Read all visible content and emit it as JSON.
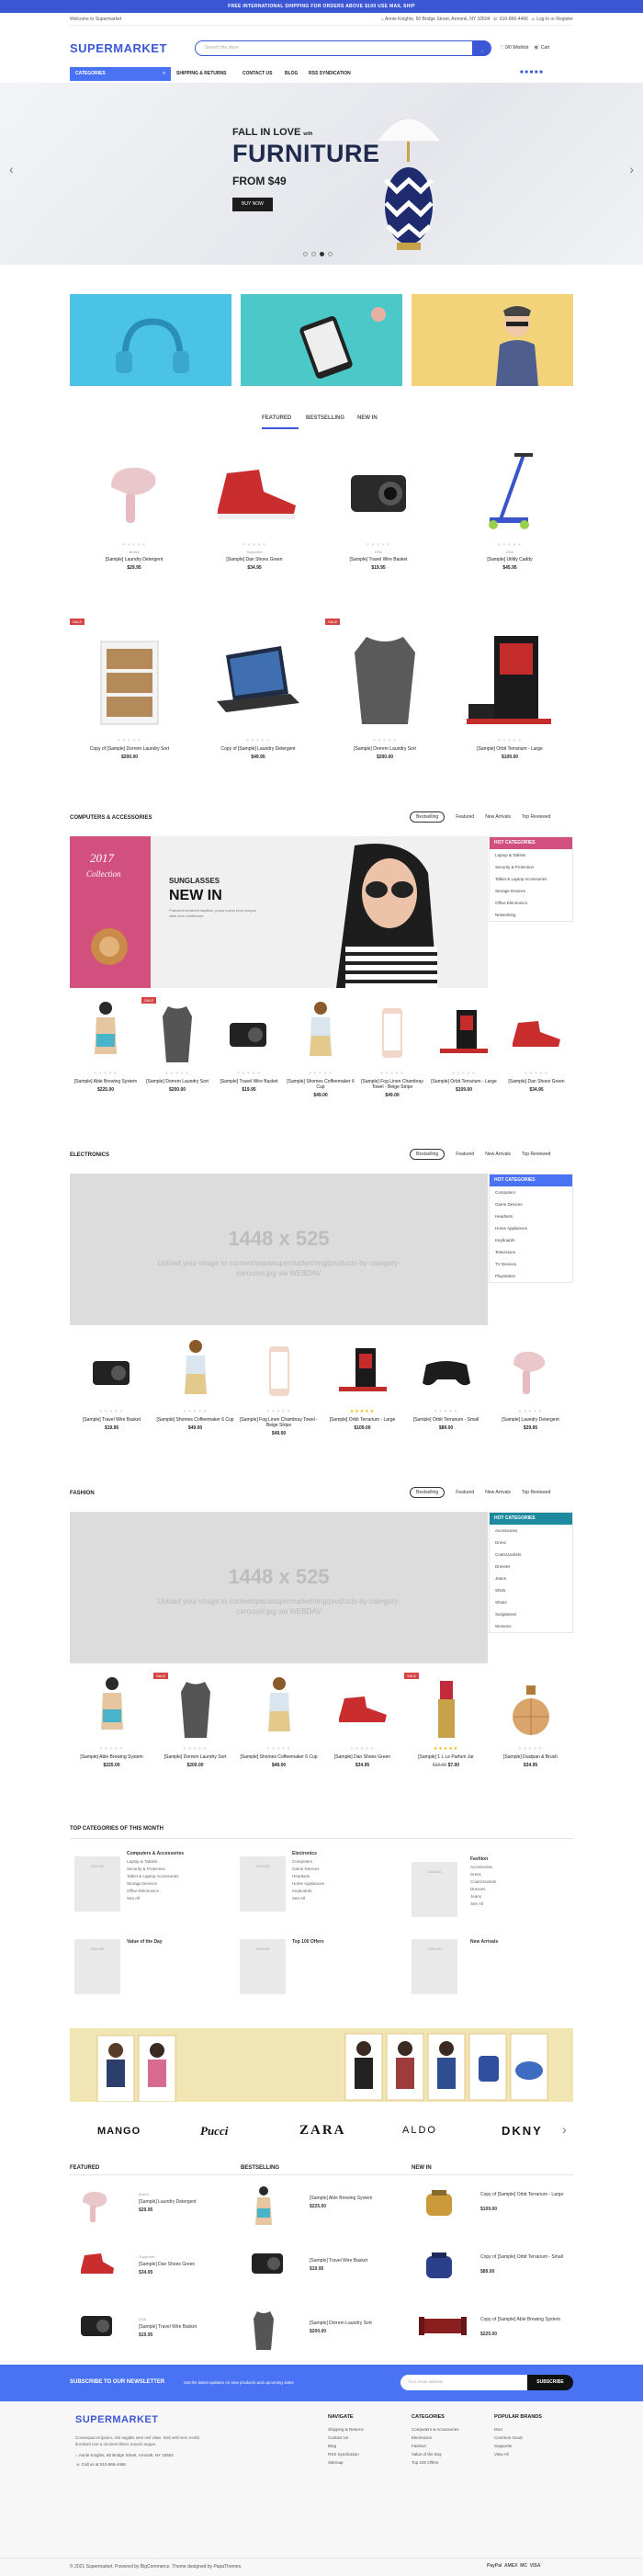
{
  "topbanner": "FREE INTERNATIONAL SHIPPING FOR ORDERS ABOVE $100 USE MAIL SHIP",
  "util": {
    "welcome": "Welcome to Supermarket",
    "address": "Annie Knights, 60 Bridge Street, Armonk, NY 10504",
    "phone": "610-866-4466",
    "login": "Log In or Register"
  },
  "header": {
    "logo": "SUPERMARKET",
    "search_placeholder": "Search the store",
    "wishlist": "0/0 Wishlist",
    "cart": "Cart"
  },
  "nav": {
    "categories": "CATEGORIES",
    "items": [
      "SHIPPING & RETURNS",
      "CONTACT US",
      "BLOG",
      "RSS SYNDICATION"
    ]
  },
  "hero": {
    "kicker": "FALL IN LOVE",
    "kicker_small": "with",
    "title": "FURNITURE",
    "price": "FROM $49",
    "button": "BUY NOW"
  },
  "tabs": [
    "FEATURED",
    "BESTSELLING",
    "NEW IN"
  ],
  "featured": [
    {
      "meta": "Brand",
      "name": "[Sample] Laundry Detergent",
      "price": "$29.95"
    },
    {
      "meta": "Supporter",
      "name": "[Sample] Dan Shoes Green",
      "price": "$34.95"
    },
    {
      "meta": "DSA",
      "name": "[Sample] Travel Wire Basket",
      "price": "$19.95"
    },
    {
      "meta": "DSA",
      "name": "[Sample] Utility Caddy",
      "price": "$45.95"
    },
    {
      "meta": "",
      "name": "Copy of [Sample] Dorrem Laundry Sort",
      "price": "$200.00",
      "badge": "SALE"
    },
    {
      "meta": "",
      "name": "Copy of [Sample] Laundry Detergent",
      "price": "$49.95"
    },
    {
      "meta": "",
      "name": "[Sample] Dorrem Laundry Sort",
      "price": "$200.00",
      "badge": "SALE"
    },
    {
      "meta": "",
      "name": "[Sample] Orbit Terrarium - Large",
      "price": "$109.00"
    }
  ],
  "sections": {
    "computers": {
      "title": "COMPUTERS & ACCESSORIES",
      "tabs": [
        "Bestselling",
        "Featured",
        "New Arrivals",
        "Top Reviewed"
      ],
      "banner_year": "2017",
      "banner_collection": "Collection",
      "banner_kicker": "SUNGLASSES",
      "banner_title": "NEW IN",
      "banner_text": "Praesent hendrerit dapibus, purus luctus eros congue vitae sem vestibulum.",
      "hot": "HOT CATEGORIES",
      "hot_items": [
        "Laptop & Tablets",
        "Security & Protection",
        "Tablet & Laptop Accessories",
        "Storage Devices",
        "Office Electronics",
        "Networking"
      ],
      "products": [
        {
          "name": "[Sample] Able Brewing System",
          "price": "$225.00"
        },
        {
          "name": "[Sample] Dorrem Laundry Sort",
          "price": "$200.00",
          "badge": "SALE"
        },
        {
          "name": "[Sample] Travel Wire Basket",
          "price": "$19.95"
        },
        {
          "name": "[Sample] Shomes Coffeemaker 6 Cup",
          "price": "$49.00"
        },
        {
          "name": "[Sample] Fog Linen Chambray Towel - Beige Stripe",
          "price": "$49.00"
        },
        {
          "name": "[Sample] Orbit Terrarium - Large",
          "price": "$109.00"
        },
        {
          "name": "[Sample] Dan Shoes Green",
          "price": "$34.95"
        }
      ]
    },
    "electronics": {
      "title": "ELECTRONICS",
      "tabs": [
        "Bestselling",
        "Featured",
        "New Arrivals",
        "Top Reviewed"
      ],
      "ph_size": "1448 x 525",
      "ph_text": "Upload your image to content/papasupermarket/img/products-by-category-carousel.jpg via WEBDAV",
      "hot": "HOT CATEGORIES",
      "hot_items": [
        "Computers",
        "Game Devices",
        "Headsets",
        "Home Appliances",
        "Keyboards",
        "Televisions",
        "TV Devices",
        "Playstation"
      ],
      "products": [
        {
          "name": "[Sample] Travel Wire Basket",
          "price": "$19.95"
        },
        {
          "name": "[Sample] Shomes Coffeemaker 6 Cup",
          "price": "$49.00"
        },
        {
          "name": "[Sample] Fog Linen Chambray Towel - Beige Stripe",
          "price": "$49.00"
        },
        {
          "name": "[Sample] Orbit Terrarium - Large",
          "price": "$109.00"
        },
        {
          "name": "[Sample] Orbit Terrarium - Small",
          "price": "$89.00"
        },
        {
          "name": "[Sample] Laundry Detergent",
          "price": "$29.95"
        }
      ]
    },
    "fashion": {
      "title": "FASHION",
      "tabs": [
        "Bestselling",
        "Featured",
        "New Arrivals",
        "Top Reviewed"
      ],
      "ph_size": "1448 x 525",
      "ph_text": "Upload your image to content/papasupermarket/img/products-by-category-carousel.jpg via WEBDAV",
      "hot": "HOT CATEGORIES",
      "hot_items": [
        "Accessories",
        "Dress",
        "Coats/Jackets",
        "Dresses",
        "Jeans",
        "Shirts",
        "Shoes",
        "Sunglasses",
        "Womens"
      ],
      "products": [
        {
          "name": "[Sample] Able Brewing System",
          "price": "$225.00"
        },
        {
          "name": "[Sample] Dorrem Laundry Sort",
          "price": "$200.00",
          "badge": "SALE"
        },
        {
          "name": "[Sample] Shomes Coffeemaker 6 Cup",
          "price": "$49.00"
        },
        {
          "name": "[Sample] Dan Shoes Green",
          "price": "$34.95"
        },
        {
          "name": "[Sample] 1 L Le Parfum Jar",
          "price": "$7.00",
          "old": "$10.00",
          "badge": "SALE"
        },
        {
          "name": "[Sample] Dustpan & Brush",
          "price": "$34.95"
        }
      ]
    }
  },
  "topcats": {
    "title": "TOP CATEGORIES OF THIS MONTH",
    "cats": [
      {
        "name": "Computers & Accessories",
        "items": [
          "Laptop & Tablets",
          "Security & Protection",
          "Tablet & Laptop Accessories",
          "Storage Devices",
          "Office Electronics"
        ]
      },
      {
        "name": "Electronics",
        "items": [
          "Computers",
          "Game Devices",
          "Headsets",
          "Home Appliances",
          "Keyboards"
        ]
      },
      {
        "name": "Fashion",
        "items": [
          "Accessories",
          "Dress",
          "Coats/Jackets",
          "Dresses",
          "Jeans"
        ]
      },
      {
        "name": "Value of the Day",
        "items": []
      },
      {
        "name": "Top 100 Offers",
        "items": []
      },
      {
        "name": "New Arrivals",
        "items": []
      }
    ],
    "see_all": "See All",
    "ph_small": "150x150"
  },
  "brands": [
    "MANGO",
    "Pucci",
    "ZARA",
    "ALDO",
    "DKNY"
  ],
  "lists": [
    {
      "title": "FEATURED",
      "items": [
        {
          "meta": "Brand",
          "name": "[Sample] Laundry Detergent",
          "price": "$29.95"
        },
        {
          "meta": "Supporter",
          "name": "[Sample] Dan Shoes Green",
          "price": "$34.95"
        },
        {
          "meta": "DSA",
          "name": "[Sample] Travel Wire Basket",
          "price": "$19.95"
        }
      ]
    },
    {
      "title": "BESTSELLING",
      "items": [
        {
          "meta": "",
          "name": "[Sample] Able Brewing System",
          "price": "$225.00"
        },
        {
          "meta": "",
          "name": "[Sample] Travel Wire Basket",
          "price": "$19.95"
        },
        {
          "meta": "",
          "name": "[Sample] Dorrem Laundry Sort",
          "price": "$200.00"
        }
      ]
    },
    {
      "title": "NEW IN",
      "items": [
        {
          "meta": "",
          "name": "Copy of [Sample] Orbit Terrarium - Large",
          "price": "$109.00"
        },
        {
          "meta": "",
          "name": "Copy of [Sample] Orbit Terrarium - Small",
          "price": "$89.00"
        },
        {
          "meta": "",
          "name": "Copy of [Sample] Able Brewing System",
          "price": "$225.00"
        }
      ]
    }
  ],
  "newsletter": {
    "title": "SUBSCRIBE TO OUR NEWSLETTER",
    "text": "Get the latest updates on new products and upcoming sales",
    "placeholder": "Your email address",
    "button": "SUBSCRIBE"
  },
  "footer": {
    "logo": "SUPERMARKET",
    "about": "Consequat et ipsum, nisi sagittis sem nisl vitae. Sed velit sem morbi tincidunt non a sit amet libero mauris augue.",
    "address": "Annie Knights, 60 Bridge Street, Armonk, NY 10504",
    "phone": "Call us at 610-866-4466",
    "cols": [
      {
        "title": "NAVIGATE",
        "items": [
          "Shipping & Returns",
          "Contact Us",
          "Blog",
          "RSS Syndication",
          "Sitemap"
        ]
      },
      {
        "title": "CATEGORIES",
        "items": [
          "Computers & Accessories",
          "Electronics",
          "Fashion",
          "Value of the Day",
          "Top 100 Offers"
        ]
      },
      {
        "title": "POPULAR BRANDS",
        "items": [
          "DSA",
          "Common Good",
          "Supporter",
          "View All"
        ]
      }
    ],
    "copyright": "© 2021 Supermarket. Powered by BigCommerce. Theme designed by PapaThemes.",
    "payments": [
      "PayPal",
      "AMEX",
      "MC",
      "VISA"
    ]
  },
  "colors": {
    "accent": "#3b57d6",
    "sale": "#d64545",
    "pink": "#d1507e",
    "teal": "#1d8aa0"
  }
}
